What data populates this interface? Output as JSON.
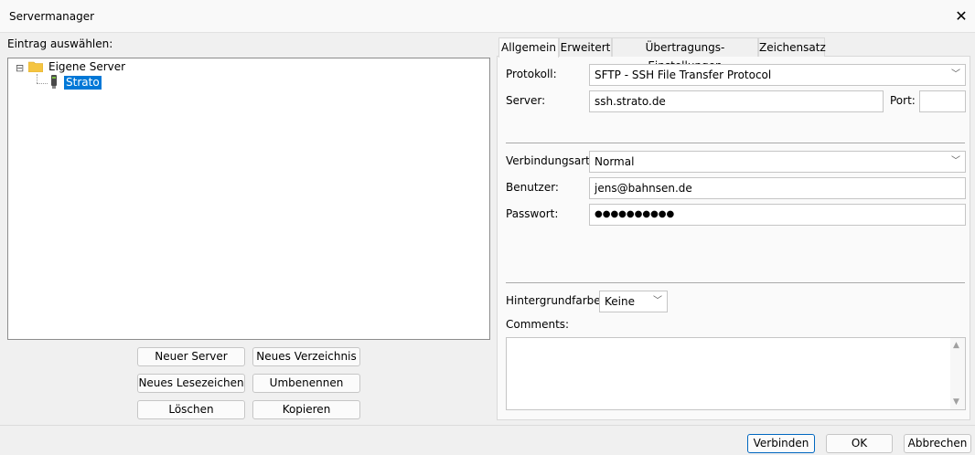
{
  "window": {
    "title": "Servermanager",
    "close_glyph": "✕"
  },
  "left": {
    "select_label": "Eintrag auswählen:",
    "tree": {
      "expander": "⊟",
      "root_label": "Eigene Server",
      "child_label": "Strato"
    },
    "buttons": {
      "new_server": "Neuer Server",
      "new_folder": "Neues Verzeichnis",
      "new_bookmark": "Neues Lesezeichen",
      "rename": "Umbenennen",
      "delete": "Löschen",
      "copy": "Kopieren"
    }
  },
  "tabs": [
    "Allgemein",
    "Erweitert",
    "Übertragungs-Einstellungen",
    "Zeichensatz"
  ],
  "general": {
    "protocol_label": "Protokoll:",
    "protocol_value": "SFTP - SSH File Transfer Protocol",
    "server_label": "Server:",
    "server_value": "ssh.strato.de",
    "port_label": "Port:",
    "port_value": "",
    "logon_label": "Verbindungsart:",
    "logon_value": "Normal",
    "user_label": "Benutzer:",
    "user_value": "jens@bahnsen.de",
    "password_label": "Passwort:",
    "password_value": "●●●●●●●●●●",
    "bg_label": "Hintergrundfarbe:",
    "bg_value": "Keine",
    "comments_label": "Comments:",
    "comments_value": ""
  },
  "footer": {
    "connect": "Verbinden",
    "ok": "OK",
    "cancel": "Abbrechen"
  },
  "colors": {
    "selection": "#0078d7",
    "folder": "#f5c542",
    "accent_border": "#0067c0"
  },
  "icons": {
    "chevron": "﹀",
    "scroll_up": "▲",
    "scroll_down": "▼"
  }
}
